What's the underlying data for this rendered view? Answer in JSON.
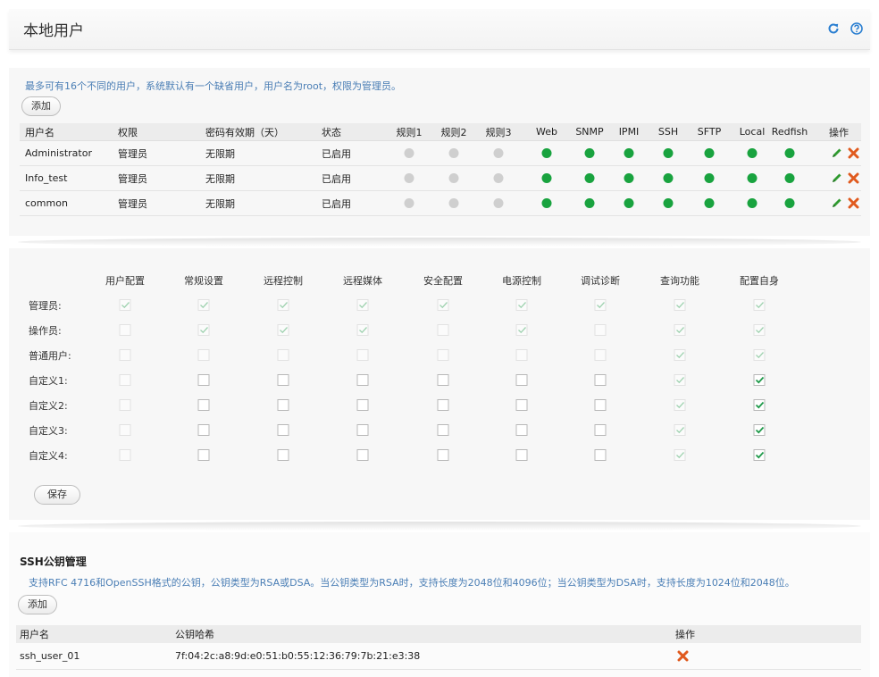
{
  "header": {
    "title": "本地用户",
    "refresh_icon": "refresh-icon",
    "help_icon": "help-icon",
    "accent": "#2b7fd1"
  },
  "users": {
    "hint": "最多可有16个不同的用户，系统默认有一个缺省用户，用户名为root，权限为管理员。",
    "add_label": "添加",
    "columns": [
      "用户名",
      "权限",
      "密码有效期（天）",
      "状态",
      "规则1",
      "规则2",
      "规则3",
      "Web",
      "SNMP",
      "IPMI",
      "SSH",
      "SFTP",
      "Local",
      "Redfish",
      "操作"
    ],
    "rows": [
      {
        "name": "Administrator",
        "role": "管理员",
        "expiry": "无限期",
        "status": "已启用",
        "flags": [
          0,
          0,
          0,
          1,
          1,
          1,
          1,
          1,
          1,
          1
        ]
      },
      {
        "name": "Info_test",
        "role": "管理员",
        "expiry": "无限期",
        "status": "已启用",
        "flags": [
          0,
          0,
          0,
          1,
          1,
          1,
          1,
          1,
          1,
          1
        ]
      },
      {
        "name": "common",
        "role": "管理员",
        "expiry": "无限期",
        "status": "已启用",
        "flags": [
          0,
          0,
          0,
          1,
          1,
          1,
          1,
          1,
          1,
          1
        ]
      }
    ],
    "status_colors": {
      "enabled": "#19a33f",
      "disabled": "#cfcfcf"
    }
  },
  "permissions": {
    "columns": [
      "用户配置",
      "常规设置",
      "远程控制",
      "远程媒体",
      "安全配置",
      "电源控制",
      "调试诊断",
      "查询功能",
      "配置自身"
    ],
    "rows": [
      {
        "label": "管理员:",
        "cells": [
          "fc",
          "fc",
          "fc",
          "fc",
          "fc",
          "fc",
          "fc",
          "fc",
          "fc"
        ]
      },
      {
        "label": "操作员:",
        "cells": [
          "fe",
          "fc",
          "fc",
          "fc",
          "fe",
          "fc",
          "fe",
          "fc",
          "fc"
        ]
      },
      {
        "label": "普通用户:",
        "cells": [
          "fe",
          "fe",
          "fe",
          "fe",
          "fe",
          "fe",
          "fe",
          "fc",
          "fc"
        ]
      },
      {
        "label": "自定义1:",
        "cells": [
          "fe",
          "e",
          "e",
          "e",
          "e",
          "e",
          "e",
          "fc",
          "c"
        ]
      },
      {
        "label": "自定义2:",
        "cells": [
          "fe",
          "e",
          "e",
          "e",
          "e",
          "e",
          "e",
          "fc",
          "c"
        ]
      },
      {
        "label": "自定义3:",
        "cells": [
          "fe",
          "e",
          "e",
          "e",
          "e",
          "e",
          "e",
          "fc",
          "c"
        ]
      },
      {
        "label": "自定义4:",
        "cells": [
          "fe",
          "e",
          "e",
          "e",
          "e",
          "e",
          "e",
          "fc",
          "c"
        ]
      }
    ],
    "save_label": "保存"
  },
  "ssh": {
    "title": "SSH公钥管理",
    "hint": "支持RFC 4716和OpenSSH格式的公钥，公钥类型为RSA或DSA。当公钥类型为RSA时，支持长度为2048位和4096位；当公钥类型为DSA时，支持长度为1024位和2048位。",
    "add_label": "添加",
    "columns": [
      "用户名",
      "公钥哈希",
      "操作"
    ],
    "rows": [
      {
        "user": "ssh_user_01",
        "hash": "7f:04:2c:a8:9d:e0:51:b0:55:12:36:79:7b:21:e3:38"
      }
    ]
  }
}
